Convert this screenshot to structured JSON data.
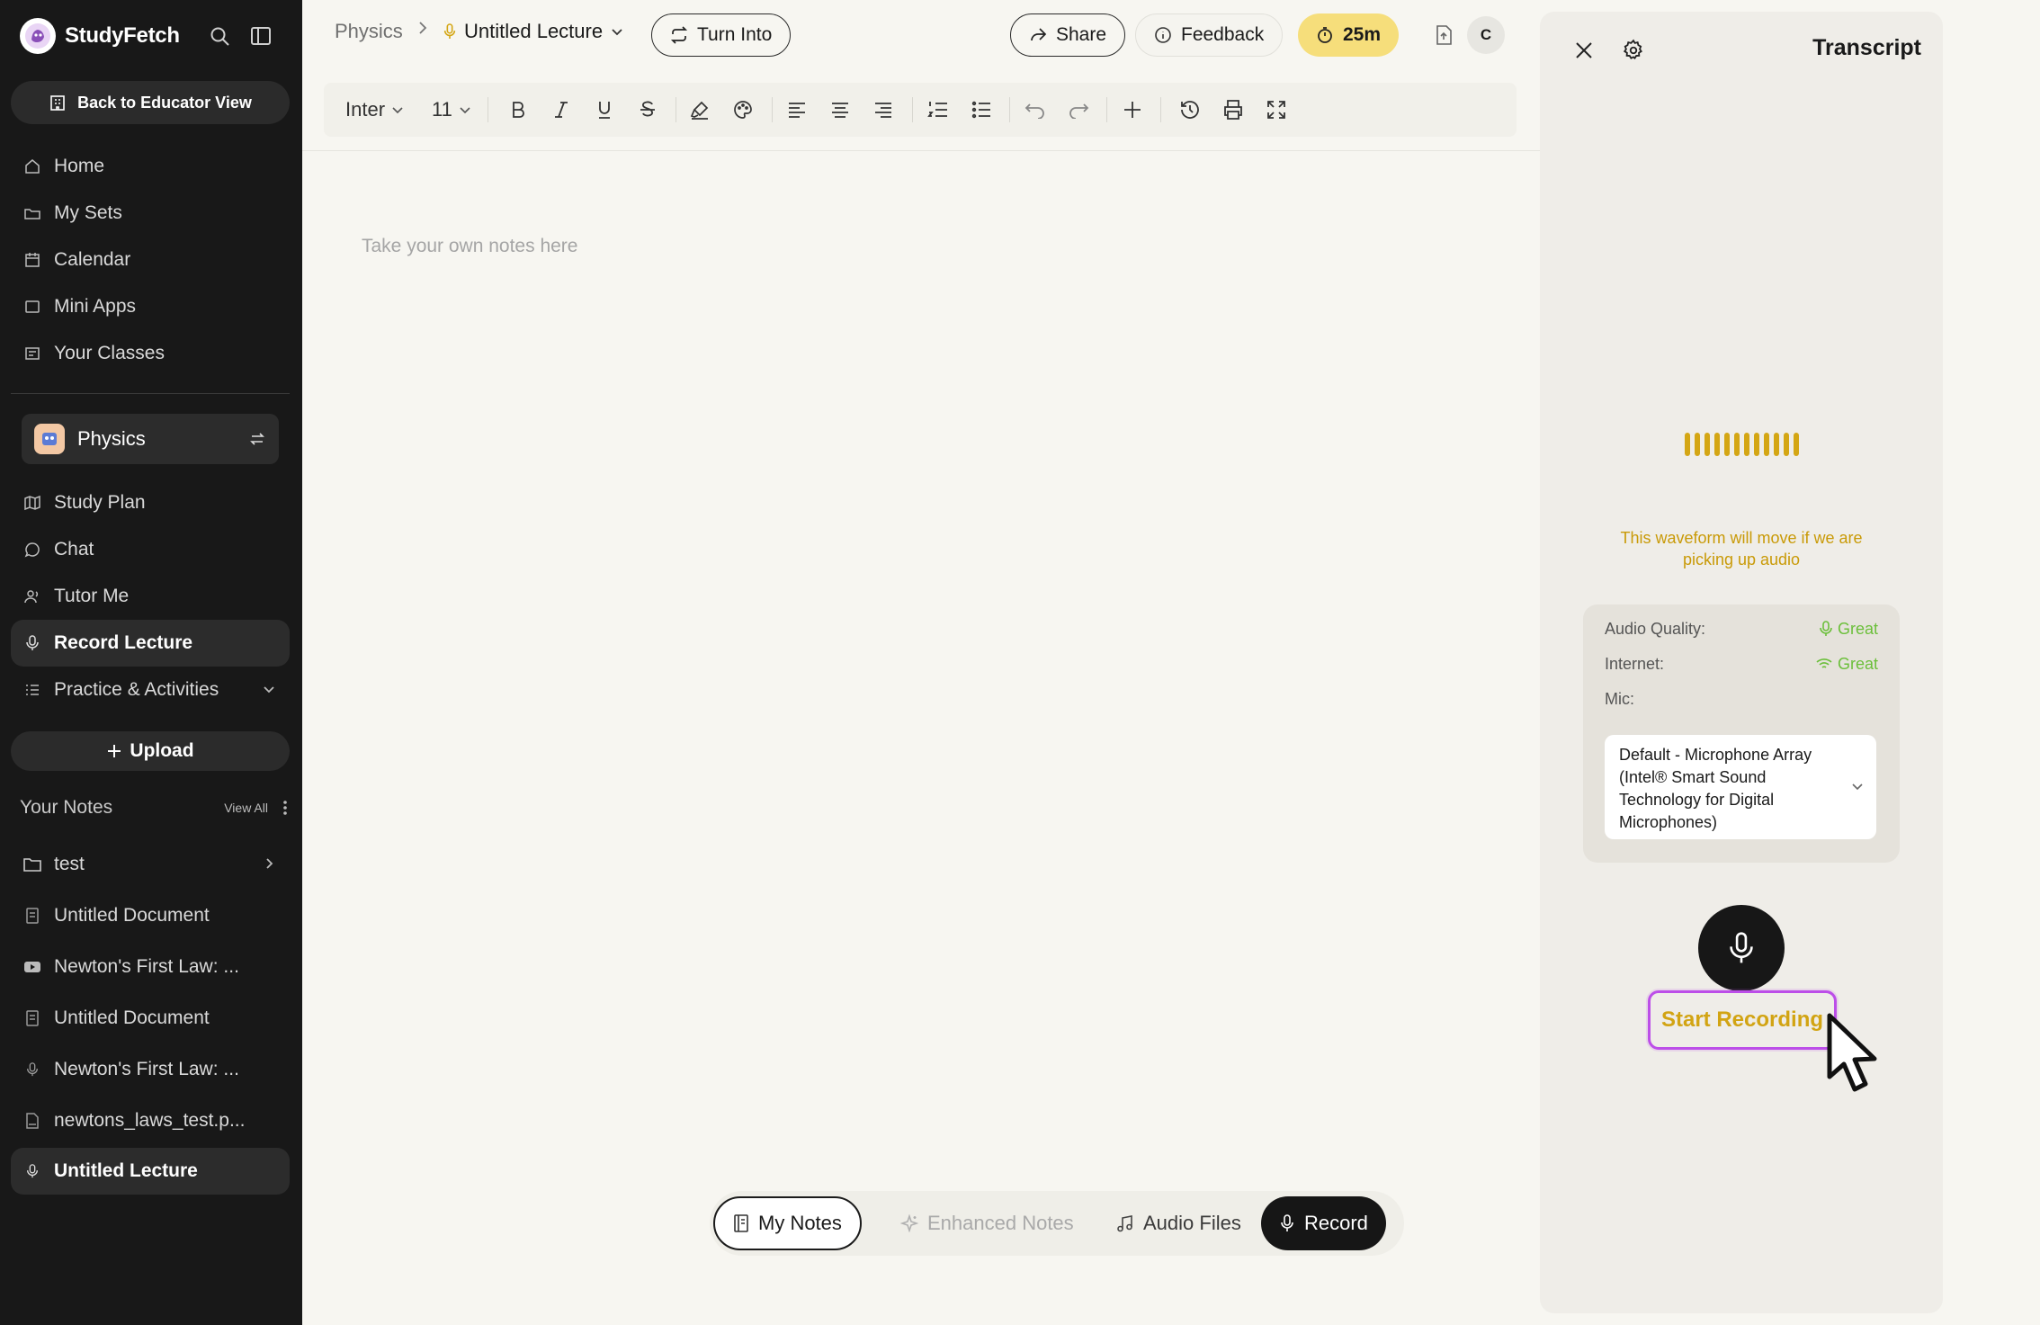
{
  "sidebar": {
    "brand": "StudyFetch",
    "back_label": "Back to Educator View",
    "nav": [
      {
        "label": "Home",
        "icon": "home-icon"
      },
      {
        "label": "My Sets",
        "icon": "folders-icon"
      },
      {
        "label": "Calendar",
        "icon": "calendar-icon"
      },
      {
        "label": "Mini Apps",
        "icon": "apps-icon"
      },
      {
        "label": "Your Classes",
        "icon": "classes-icon"
      }
    ],
    "class_name": "Physics",
    "class_nav": [
      {
        "label": "Study Plan",
        "icon": "map-icon"
      },
      {
        "label": "Chat",
        "icon": "chat-icon"
      },
      {
        "label": "Tutor Me",
        "icon": "tutor-icon"
      },
      {
        "label": "Record Lecture",
        "icon": "mic-icon",
        "active": true
      },
      {
        "label": "Practice & Activities",
        "icon": "list-icon"
      }
    ],
    "upload_label": "Upload",
    "notes_title": "Your Notes",
    "view_all": "View All",
    "notes": [
      {
        "label": "test",
        "icon": "folder-icon"
      },
      {
        "label": "Untitled Document",
        "icon": "document-icon"
      },
      {
        "label": "Newton's First Law: ...",
        "icon": "youtube-icon"
      },
      {
        "label": "Untitled Document",
        "icon": "document-icon"
      },
      {
        "label": "Newton's First Law: ...",
        "icon": "mic-icon"
      },
      {
        "label": "newtons_laws_test.p...",
        "icon": "pdf-icon"
      },
      {
        "label": "Untitled Lecture",
        "icon": "mic-icon",
        "active": true
      }
    ]
  },
  "topbar": {
    "breadcrumb_root": "Physics",
    "breadcrumb_current": "Untitled Lecture",
    "turn_into": "Turn Into",
    "share": "Share",
    "feedback": "Feedback",
    "timer": "25m",
    "avatar": "C"
  },
  "toolbar": {
    "font": "Inter",
    "size": "11"
  },
  "editor": {
    "placeholder": "Take your own notes here"
  },
  "bottom_tabs": {
    "my_notes": "My Notes",
    "enhanced": "Enhanced Notes",
    "audio": "Audio Files",
    "record": "Record"
  },
  "panel": {
    "title": "Transcript",
    "waveform_note": "This waveform will move if we are picking up audio",
    "audio_quality_label": "Audio Quality:",
    "audio_quality_value": "Great",
    "internet_label": "Internet:",
    "internet_value": "Great",
    "mic_label": "Mic:",
    "mic_value": "Default - Microphone Array (Intel® Smart Sound Technology for Digital Microphones)",
    "start_recording": "Start Recording"
  },
  "colors": {
    "accent_yellow": "#d4a614",
    "timer_bg": "#f6de7b",
    "great_green": "#6bbf3a",
    "focus_purple": "#bc4ee8",
    "sidebar_bg": "#181818"
  }
}
